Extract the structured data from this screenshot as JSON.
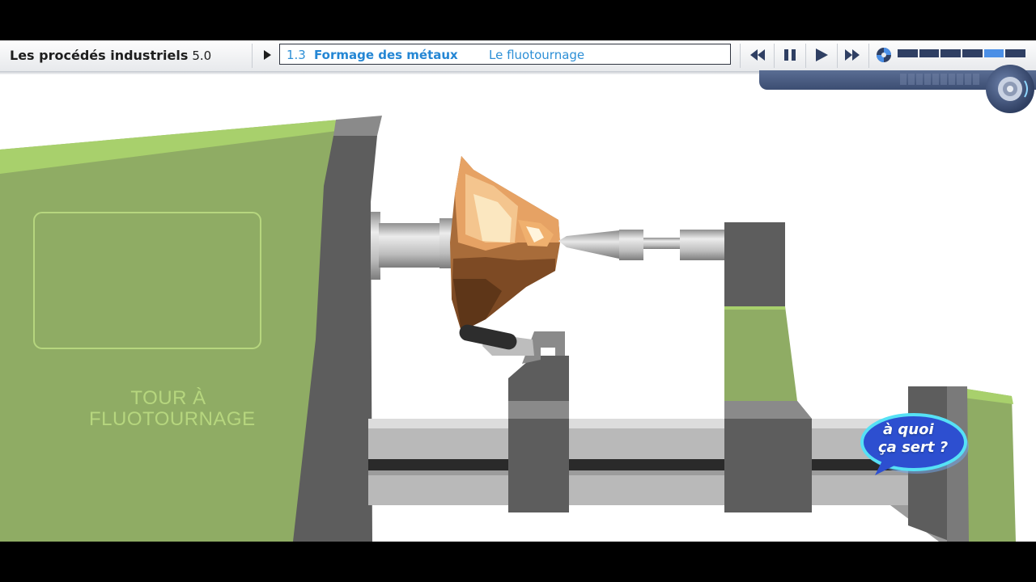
{
  "toolbar": {
    "app_title": "Les procédés industriels",
    "app_version": "5.0",
    "breadcrumb": {
      "chapter_number": "1.3",
      "chapter_title": "Formage des métaux",
      "topic": "Le fluotournage"
    },
    "controls": [
      "rewind-icon",
      "pause-icon",
      "play-icon",
      "fast-forward-icon",
      "disc-icon"
    ],
    "progress": {
      "segments": 6,
      "active_segment": 5
    }
  },
  "scene": {
    "machine_label_line1": "TOUR À",
    "machine_label_line2": "FLUOTOURNAGE",
    "badge_line1": "à quoi",
    "badge_line2": "ça sert ?"
  },
  "colors": {
    "machine_green": "#8fac64",
    "machine_green_light": "#a8d06c",
    "machine_dark": "#5d5d5d",
    "metal": "#b9b9b9",
    "accent_blue": "#2486d4",
    "bronze": "#c98a4a"
  }
}
